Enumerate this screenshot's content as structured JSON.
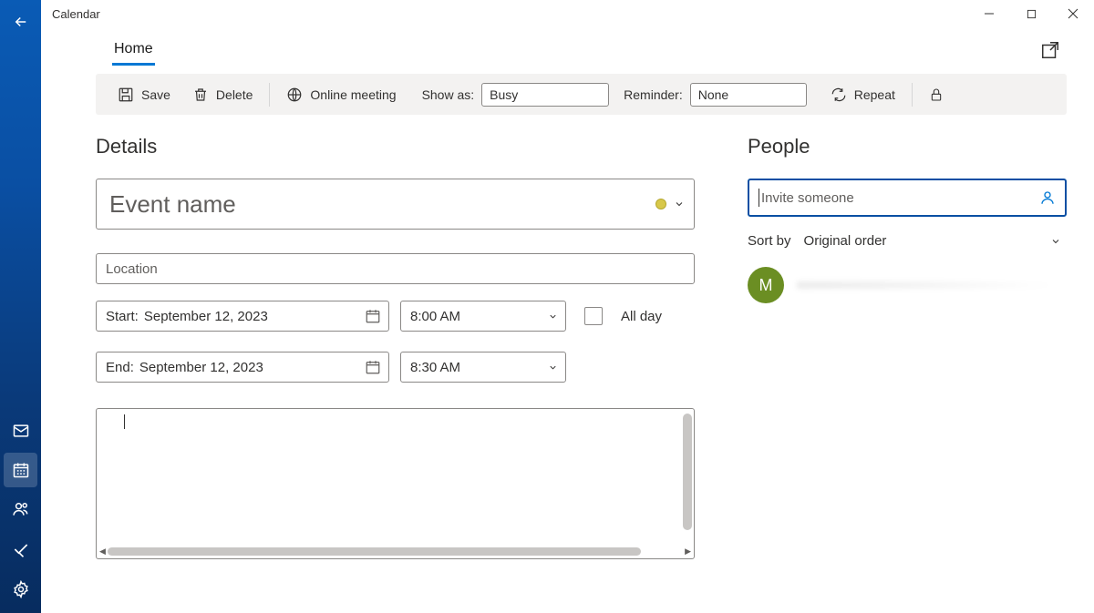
{
  "window": {
    "title": "Calendar"
  },
  "tabs": {
    "home": "Home"
  },
  "toolbar": {
    "save": "Save",
    "delete": "Delete",
    "online_meeting": "Online meeting",
    "show_as_label": "Show as:",
    "show_as_value": "Busy",
    "reminder_label": "Reminder:",
    "reminder_value": "None",
    "repeat": "Repeat"
  },
  "details": {
    "heading": "Details",
    "event_name_placeholder": "Event name",
    "location_placeholder": "Location",
    "start_label": "Start:",
    "start_date": "September 12, 2023",
    "start_time": "8:00 AM",
    "end_label": "End:",
    "end_date": "September 12, 2023",
    "end_time": "8:30 AM",
    "all_day_label": "All day"
  },
  "people": {
    "heading": "People",
    "invite_placeholder": "Invite someone",
    "sort_by_label": "Sort by",
    "sort_by_value": "Original order",
    "attendees": [
      {
        "initial": "M"
      }
    ]
  }
}
